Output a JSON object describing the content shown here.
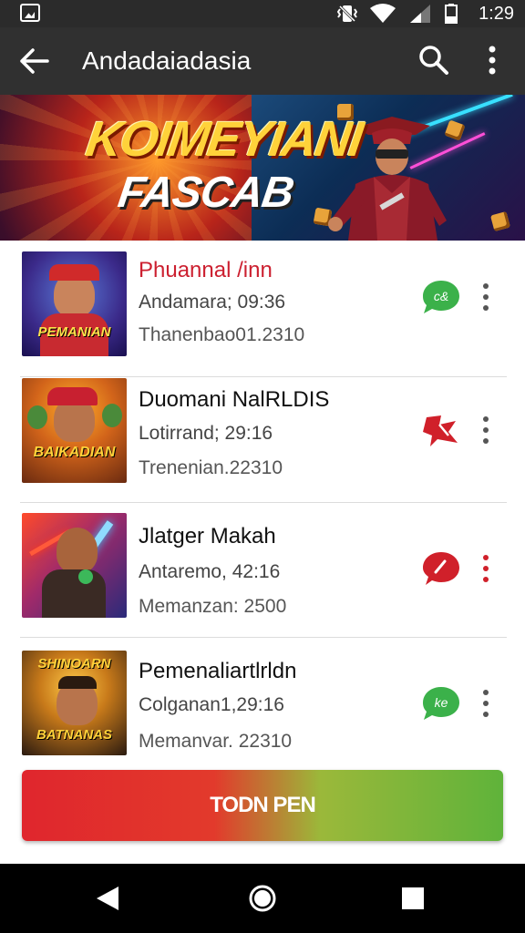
{
  "status_bar": {
    "time": "1:29",
    "icons": [
      "gallery-icon",
      "vibrate-icon",
      "wifi-icon",
      "signal-icon",
      "battery-icon"
    ]
  },
  "app_bar": {
    "title": "Andadaiadasia",
    "icons": [
      "back-arrow-icon",
      "search-icon",
      "more-vert-icon"
    ]
  },
  "banner": {
    "line1": "KOIMEYIANI",
    "line2": "FASCAB"
  },
  "items": [
    {
      "title": "Phuannal /inn",
      "line1": "Andamara; 09:36",
      "line2": "Thanenbao01.2310",
      "thumb_caption": "PEMANIAN",
      "status_icon": "chat-bubble-icon",
      "status_color": "#3bb14a",
      "title_color": "#cc2030"
    },
    {
      "title": "Duomani NalRLDIS",
      "line1": "Lotirrand; 29:16",
      "line2": "Trenenian.22310",
      "thumb_caption": "BAIKADIAN",
      "status_icon": "flag-icon",
      "status_color": "#d0202a",
      "title_color": "#111111"
    },
    {
      "title": "Jlatger Makah",
      "line1": "Antaremo, 42:16",
      "line2": "Memanzan:  2500",
      "thumb_caption": "",
      "status_icon": "chat-bubble-icon",
      "status_color": "#d0202a",
      "title_color": "#111111"
    },
    {
      "title": "Pemenaliartlrldn",
      "line1": "Colganan1,29:16",
      "line2": "Memanvar. 22310",
      "thumb_caption": "BATNANAS",
      "status_icon": "chat-bubble-icon",
      "status_color": "#3bb14a",
      "title_color": "#111111"
    }
  ],
  "cta": {
    "label": "TODN PEN"
  },
  "nav_bar": {
    "icons": [
      "nav-back-icon",
      "nav-home-icon",
      "nav-recents-icon"
    ]
  }
}
